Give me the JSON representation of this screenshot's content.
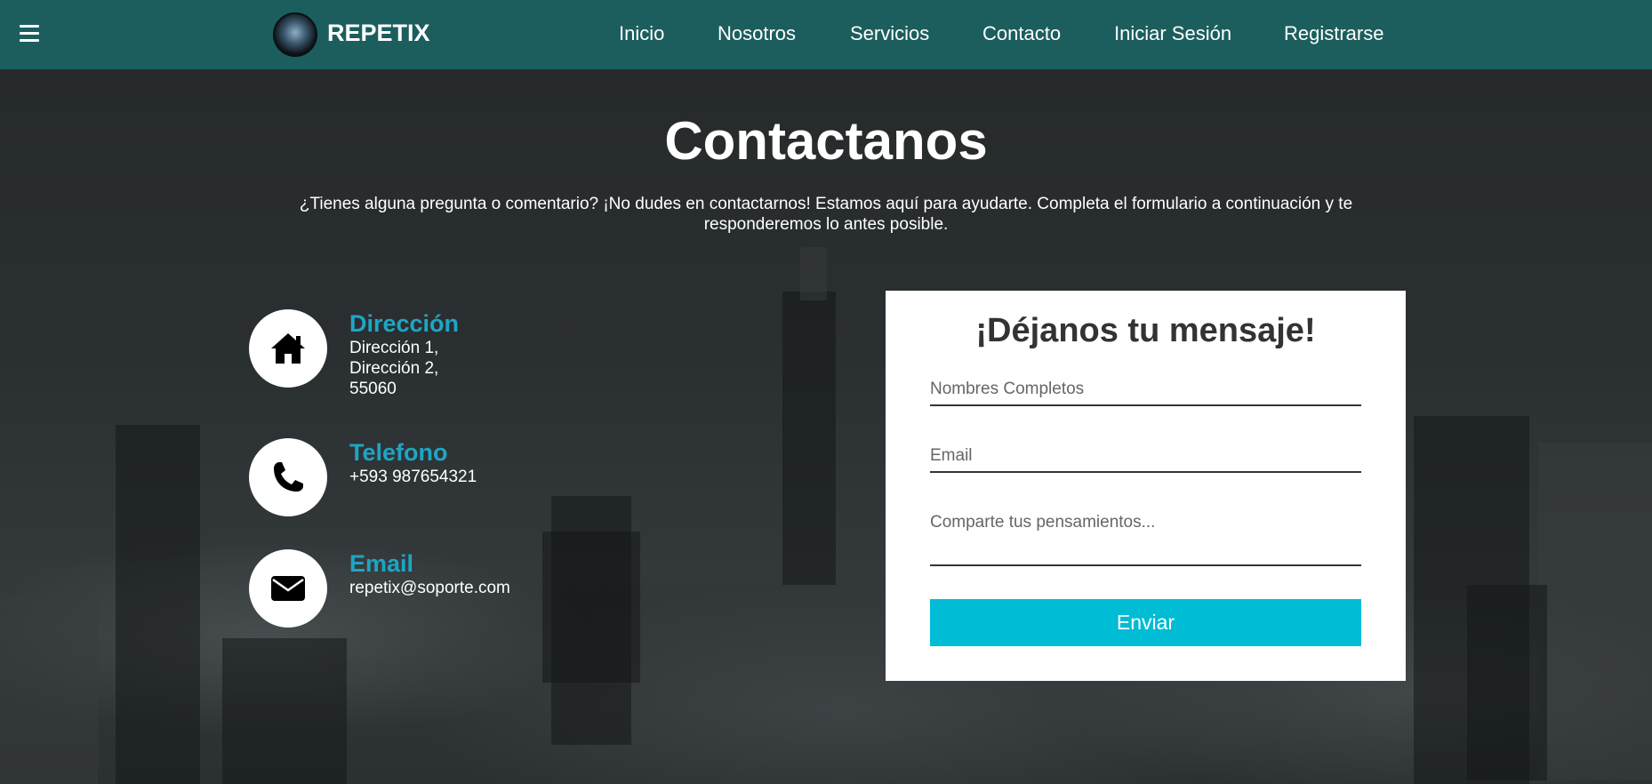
{
  "header": {
    "brand": "REPETIX",
    "nav": [
      "Inicio",
      "Nosotros",
      "Servicios",
      "Contacto",
      "Iniciar Sesión",
      "Registrarse"
    ]
  },
  "main": {
    "title": "Contactanos",
    "intro": "¿Tienes alguna pregunta o comentario? ¡No dudes en contactarnos! Estamos aquí para ayudarte. Completa el formulario a continuación y te responderemos lo antes posible.",
    "info": [
      {
        "title": "Dirección",
        "lines": [
          "Dirección 1,",
          "Dirección 2,",
          "55060"
        ],
        "icon": "home-icon"
      },
      {
        "title": "Telefono",
        "lines": [
          "+593 987654321"
        ],
        "icon": "phone-icon"
      },
      {
        "title": "Email",
        "lines": [
          "repetix@soporte.com"
        ],
        "icon": "envelope-icon"
      }
    ]
  },
  "form": {
    "title": "¡Déjanos tu mensaje!",
    "name_placeholder": "Nombres Completos",
    "email_placeholder": "Email",
    "message_placeholder": "Comparte tus pensamientos...",
    "submit_label": "Enviar"
  },
  "colors": {
    "header_bg": "#1c5e5e",
    "accent": "#1fa5c3",
    "button": "#00bcd4",
    "page_bg": "#252a2b"
  }
}
